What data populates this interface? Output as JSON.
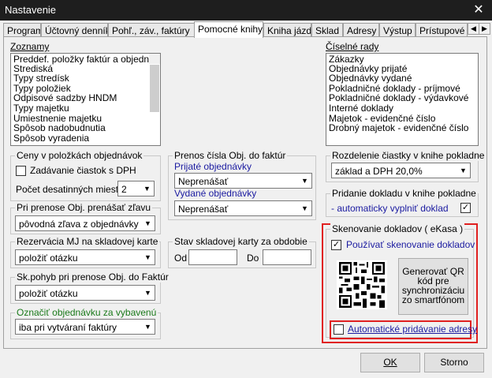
{
  "window": {
    "title": "Nastavenie",
    "close_glyph": "✕"
  },
  "tabs": [
    "Program",
    "Účtovný denník",
    "Pohľ., záv., faktúry",
    "Pomocné knihy",
    "Kniha jázd",
    "Sklad",
    "Adresy",
    "Výstup",
    "Prístupové pr"
  ],
  "selected_tab": "Pomocné knihy",
  "zoznamy": {
    "label": "Zoznamy",
    "items": [
      "Preddef. položky faktúr a objednávok",
      "Strediská",
      "Typy stredísk",
      "Typy položiek",
      "Odpisové sadzby HNDM",
      "Typy majetku",
      "Umiestnenie majetku",
      "Spôsob nadobudnutia",
      "Spôsob vyradenia"
    ]
  },
  "ciselne_rady": {
    "label": "Číselné rady",
    "items": [
      "Zákazky",
      "Objednávky prijaté",
      "Objednávky vydané",
      "Pokladničné doklady - príjmové",
      "Pokladničné doklady - výdavkové",
      "Interné doklady",
      "Majetok - evidenčné číslo",
      "Drobný majetok - evidenčné číslo"
    ]
  },
  "ceny": {
    "title": "Ceny v položkách objednávok",
    "checkbox_label": "Zadávanie čiastok s DPH",
    "decimals_label": "Počet desatinných miest",
    "decimals_value": "2"
  },
  "prenos_cisla": {
    "title": "Prenos čísla Obj. do faktúr",
    "prijate_label": "Prijaté objednávky",
    "prijate_value": "Neprenášať",
    "vydane_label": "Vydané objednávky",
    "vydane_value": "Neprenášať"
  },
  "pri_prenose": {
    "title": "Pri prenose Obj. prenášať zľavu",
    "value": "pôvodná zľava z objednávky"
  },
  "rezervacia": {
    "title": "Rezervácia MJ na skladovej karte",
    "value": "položiť otázku"
  },
  "stav_skladovej": {
    "title": "Stav skladovej karty za obdobie",
    "od_label": "Od",
    "do_label": "Do",
    "od_value": "",
    "do_value": ""
  },
  "sk_pohyb": {
    "title": "Sk.pohyb pri prenose Obj. do Faktúr",
    "value": "položiť otázku"
  },
  "oznacit": {
    "title": "Označiť objednávku za vybavenú",
    "value": "iba pri vytváraní faktúry"
  },
  "rozdelenie": {
    "title": "Rozdelenie čiastky v knihe pokladne",
    "value": "základ a DPH 20,0%"
  },
  "pridanie": {
    "title": "Pridanie dokladu v knihe pokladne",
    "checkbox_label": "- automaticky vyplniť doklad",
    "checked": true
  },
  "skenovanie": {
    "title": "Skenovanie dokladov ( eKasa )",
    "use_label": "Používať skenovanie dokladov",
    "use_checked": true,
    "qr_button_label": "Generovať QR kód pre synchronizáciu zo smartfónom",
    "auto_address_label": "Automatické pridávanie adresy",
    "auto_address_checked": false
  },
  "footer": {
    "ok_label": "OK",
    "cancel_label": "Storno"
  },
  "colors": {
    "highlight_red": "#e02020",
    "link_blue": "#1a1aa0",
    "title_green": "#1a7a1a"
  },
  "icons": {
    "checkmark": "✓",
    "dropdown": "▼",
    "scroll_left": "◀",
    "scroll_right": "▶"
  }
}
